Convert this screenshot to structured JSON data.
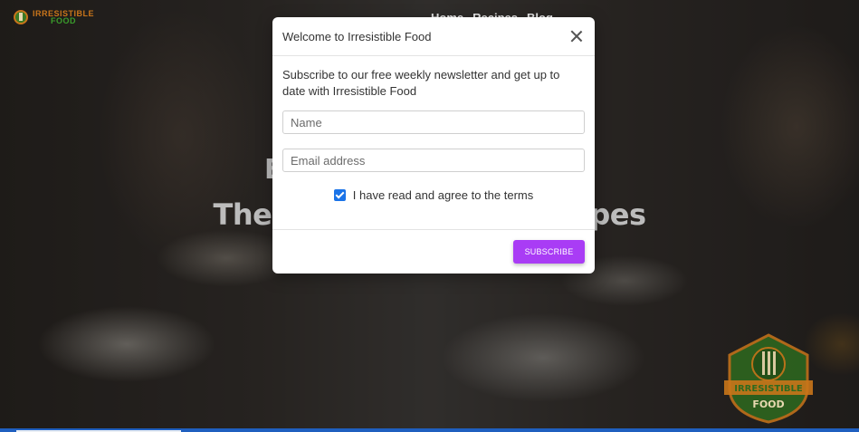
{
  "site": {
    "logo_line1": "IRRESISTIBLE",
    "logo_line2": "FOOD",
    "nav": [
      "Home",
      "Recipes",
      "Blog"
    ]
  },
  "hero": {
    "title": "The Natural T                              ne & Recipes"
  },
  "badge": {
    "line1": "IRRESISTIBLE",
    "line2": "FOOD"
  },
  "modal": {
    "title": "Welcome to Irresistible Food",
    "intro": "Subscribe to our free weekly newsletter and get up to date with Irresistible Food",
    "name_placeholder": "Name",
    "email_placeholder": "Email address",
    "terms_label": "I have read and agree to the terms",
    "terms_checked": true,
    "subscribe_label": "SUBSCRIBE"
  },
  "colors": {
    "accent": "#a93cf5",
    "checkbox": "#1a73e8",
    "footer_bar": "#1f5fbf"
  }
}
